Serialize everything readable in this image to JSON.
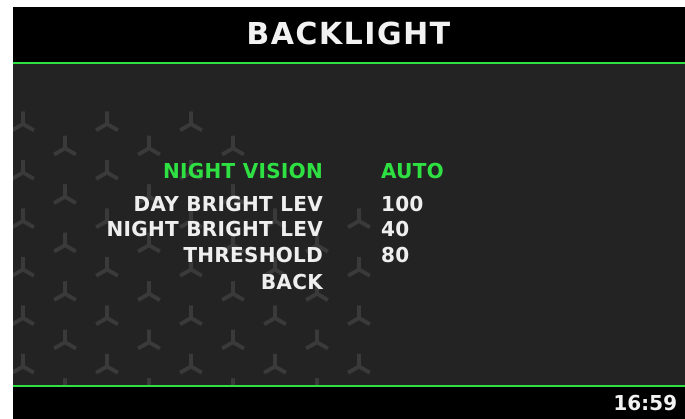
{
  "screen": {
    "title": "BACKLIGHT",
    "accent_color": "#2fe043",
    "background_color": "#232323",
    "text_color": "#efefef"
  },
  "menu": {
    "items": [
      {
        "label": "NIGHT VISION",
        "value": "AUTO",
        "selected": true
      },
      {
        "label": "DAY BRIGHT LEV",
        "value": "100",
        "selected": false
      },
      {
        "label": "NIGHT BRIGHT LEV",
        "value": "40",
        "selected": false
      },
      {
        "label": "THRESHOLD",
        "value": "80",
        "selected": false
      },
      {
        "label": "BACK",
        "value": "",
        "selected": false
      }
    ]
  },
  "footer": {
    "clock": "16:59"
  }
}
